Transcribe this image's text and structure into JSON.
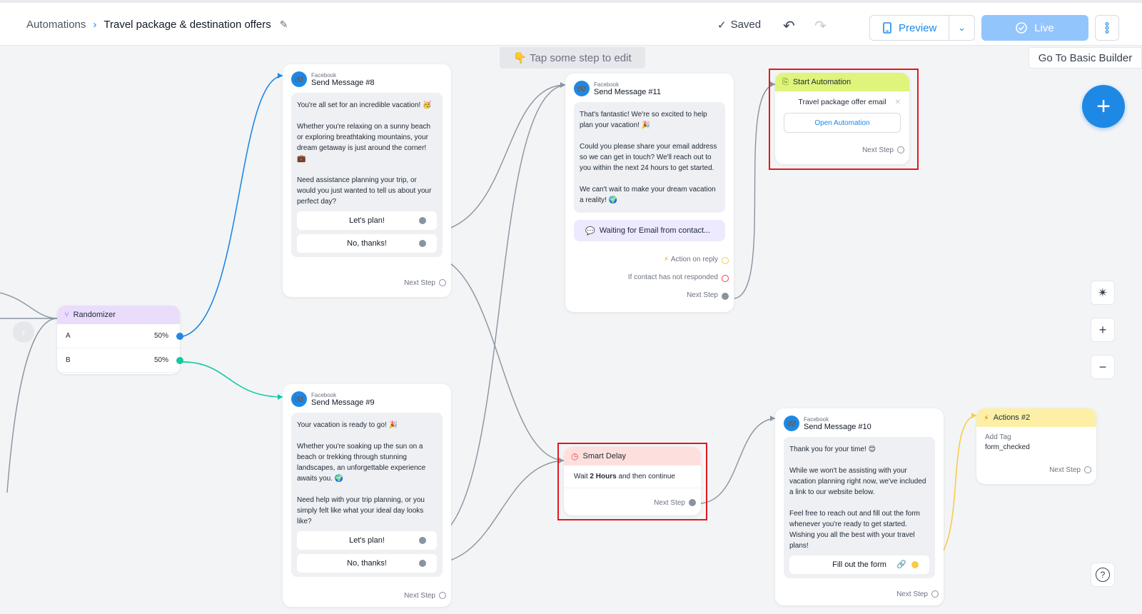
{
  "header": {
    "breadcrumb_root": "Automations",
    "breadcrumb_title": "Travel package & destination offers",
    "saved_label": "Saved",
    "preview_label": "Preview",
    "live_label": "Live"
  },
  "canvas": {
    "hint": "Tap some step to edit",
    "basic_builder": "Go To Basic Builder"
  },
  "randomizer": {
    "title": "Randomizer",
    "rows": [
      {
        "label": "A",
        "value": "50%"
      },
      {
        "label": "B",
        "value": "50%"
      }
    ]
  },
  "send8": {
    "platform": "Facebook",
    "title": "Send Message #8",
    "paragraphs": [
      "You're all set for an incredible vacation! 🥳",
      "Whether you're relaxing on a sunny beach or exploring breathtaking mountains, your dream getaway is just around the corner! 💼",
      "Need assistance planning your trip, or would you just wanted to tell us about your perfect day?"
    ],
    "buttons": [
      "Let's plan!",
      "No, thanks!"
    ],
    "next_step": "Next Step"
  },
  "send9": {
    "platform": "Facebook",
    "title": "Send Message #9",
    "paragraphs": [
      "Your vacation is ready to go! 🎉",
      "Whether you're soaking up the sun on a beach or trekking through stunning landscapes, an unforgettable experience awaits you. 🌍",
      "Need help with your trip planning, or you simply felt like what your ideal day looks like?"
    ],
    "buttons": [
      "Let's plan!",
      "No, thanks!"
    ],
    "next_step": "Next Step"
  },
  "send11": {
    "platform": "Facebook",
    "title": "Send Message #11",
    "paragraphs": [
      "That's fantastic! We're so excited to help plan your vacation! 🎉",
      "Could you please share your email address so we can get in touch? We'll reach out to you within the next 24 hours to get started.",
      "We can't wait to make your dream vacation a reality! 🌍"
    ],
    "waiting": "Waiting for Email from contact...",
    "action_on_reply": "Action on reply",
    "not_responded": "If contact has not responded",
    "next_step": "Next Step"
  },
  "start_automation": {
    "title": "Start Automation",
    "automation_name": "Travel package offer email",
    "open_button": "Open Automation",
    "next_step": "Next Step"
  },
  "smart_delay": {
    "title": "Smart Delay",
    "wait_prefix": "Wait",
    "wait_value": "2 Hours",
    "wait_suffix": "and then continue",
    "next_step": "Next Step"
  },
  "send10": {
    "platform": "Facebook",
    "title": "Send Message #10",
    "paragraphs": [
      "Thank you for your time! 😊",
      "While we won't be assisting with your vacation planning right now, we've included a link to our website below.",
      "Feel free to reach out and fill out the form whenever you're ready to get started. Wishing you all the best with your travel plans!"
    ],
    "button": "Fill out the form",
    "next_step": "Next Step"
  },
  "actions2": {
    "title": "Actions #2",
    "action_label": "Add Tag",
    "action_value": "form_checked",
    "next_step": "Next Step"
  },
  "colors": {
    "accent": "#1e88e5",
    "randomizer_header": "#e9ddfb",
    "start_header": "#dff47a",
    "delay_header": "#fde0dd",
    "actions_header": "#fdf0a6",
    "edge_blue": "#1e88e5",
    "edge_green": "#10c9a0",
    "edge_gray": "#8a93a0",
    "edge_yellow": "#f8cc4a",
    "highlight_red": "#e1181f"
  }
}
